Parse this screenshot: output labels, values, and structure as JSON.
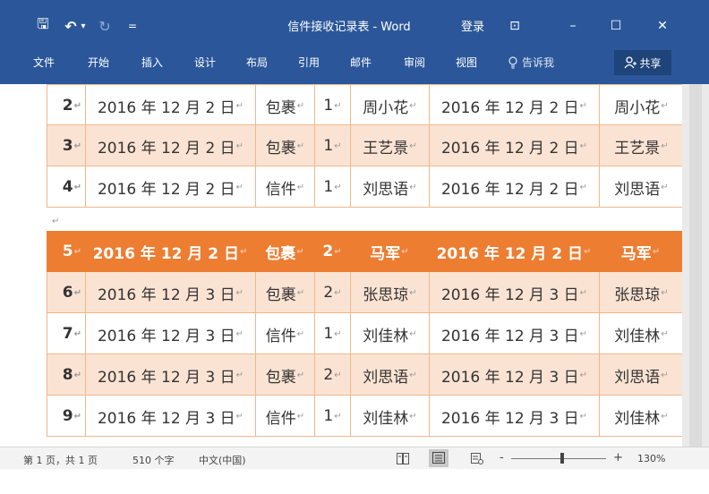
{
  "window": {
    "title": "信件接收记录表 - Word",
    "login": "登录",
    "qat": {
      "save": "🖫",
      "undo": "↶",
      "undo_drop": "▾",
      "redo": "↻",
      "customize": "="
    },
    "buttons": {
      "ribbon_display": "⊡",
      "minimize": "–",
      "maximize": "☐",
      "close": "✕"
    }
  },
  "ribbon": {
    "tabs": [
      "文件",
      "开始",
      "插入",
      "设计",
      "布局",
      "引用",
      "邮件",
      "审阅",
      "视图"
    ],
    "tell_me": "告诉我",
    "share": "共享"
  },
  "table": {
    "rows": [
      {
        "num": "2",
        "date1": "2016 年 12 月 2 日",
        "type": "包裹",
        "qty": "1",
        "name1": "周小花",
        "date2": "2016 年 12 月 2 日",
        "name2": "周小花",
        "style": "white"
      },
      {
        "num": "3",
        "date1": "2016 年 12 月 2 日",
        "type": "包裹",
        "qty": "1",
        "name1": "王艺景",
        "date2": "2016 年 12 月 2 日",
        "name2": "王艺景",
        "style": "light"
      },
      {
        "num": "4",
        "date1": "2016 年 12 月 2 日",
        "type": "信件",
        "qty": "1",
        "name1": "刘思语",
        "date2": "2016 年 12 月 2 日",
        "name2": "刘思语",
        "style": "white"
      },
      {
        "num": "5",
        "date1": "2016 年 12 月 2 日",
        "type": "包裹",
        "qty": "2",
        "name1": "马军",
        "date2": "2016 年 12 月 2 日",
        "name2": "马军",
        "style": "hl"
      },
      {
        "num": "6",
        "date1": "2016 年 12 月 3 日",
        "type": "包裹",
        "qty": "2",
        "name1": "张思琼",
        "date2": "2016 年 12 月 3 日",
        "name2": "张思琼",
        "style": "light"
      },
      {
        "num": "7",
        "date1": "2016 年 12 月 3 日",
        "type": "信件",
        "qty": "1",
        "name1": "刘佳林",
        "date2": "2016 年 12 月 3 日",
        "name2": "刘佳林",
        "style": "white"
      },
      {
        "num": "8",
        "date1": "2016 年 12 月 3 日",
        "type": "包裹",
        "qty": "2",
        "name1": "刘思语",
        "date2": "2016 年 12 月 3 日",
        "name2": "刘思语",
        "style": "light"
      },
      {
        "num": "9",
        "date1": "2016 年 12 月 3 日",
        "type": "信件",
        "qty": "1",
        "name1": "刘佳林",
        "date2": "2016 年 12 月 3 日",
        "name2": "刘佳林",
        "style": "white"
      }
    ],
    "cell_mark": "↵",
    "paragraph_mark": "↵"
  },
  "status": {
    "page": "第 1 页，共 1 页",
    "words": "510 个字",
    "language": "中文(中国)",
    "zoom_minus": "-",
    "zoom_plus": "+",
    "zoom": "130%"
  },
  "colors": {
    "brand": "#2b579a",
    "table_accent": "#ed7d31",
    "table_light": "#fbe3d3"
  }
}
